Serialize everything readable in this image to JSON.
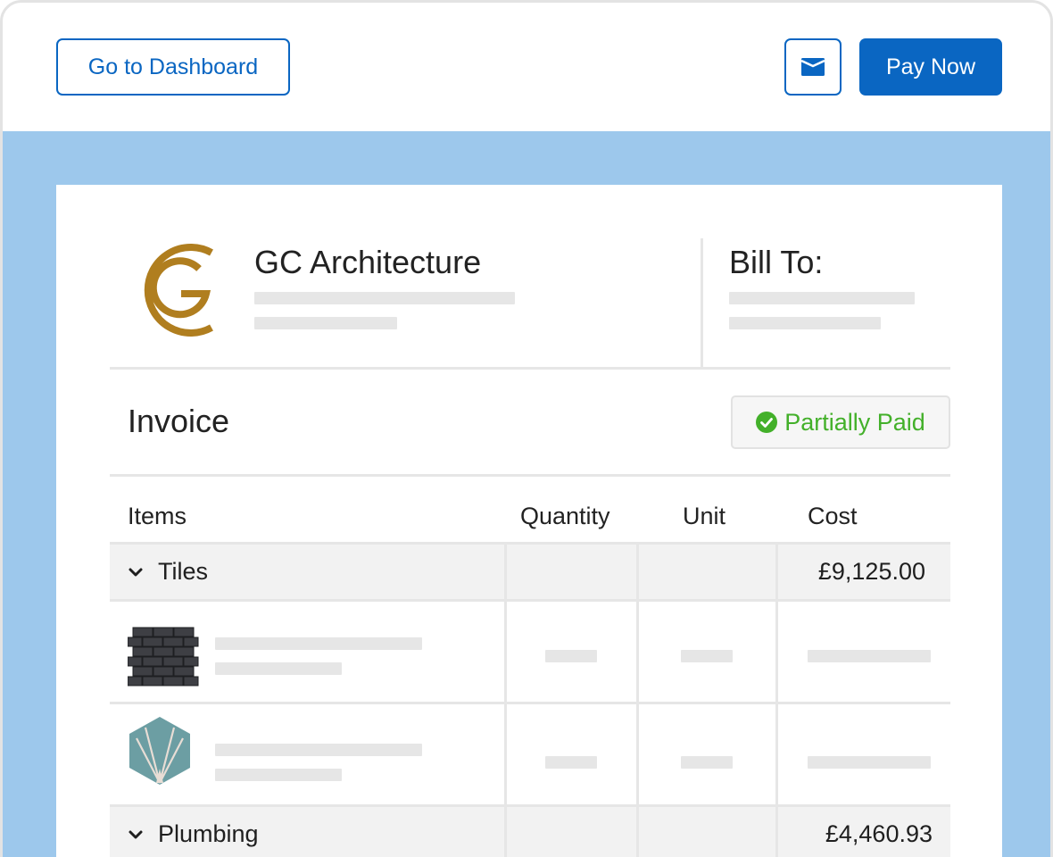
{
  "toolbar": {
    "dashboard_label": "Go to Dashboard",
    "pay_label": "Pay Now",
    "mail_icon": "envelope-icon"
  },
  "company": {
    "name": "GC Architecture",
    "logo": "gc-monogram-logo",
    "logo_color": "#b07e1f"
  },
  "bill_to": {
    "label": "Bill To:"
  },
  "invoice": {
    "title": "Invoice",
    "status": "Partially Paid",
    "status_color": "#43b02a"
  },
  "table": {
    "headers": [
      "Items",
      "Quantity",
      "Unit",
      "Cost"
    ],
    "groups": [
      {
        "name": "Tiles",
        "cost": "£9,125.00"
      },
      {
        "name": "Plumbing",
        "cost": "£4,460.93"
      }
    ],
    "items": [
      {
        "thumbnail": "dark-brick-tile-thumbnail"
      },
      {
        "thumbnail": "hexagon-tile-thumbnail"
      }
    ]
  },
  "colors": {
    "accent": "#0a66c2",
    "background_band": "#9dc8ec",
    "placeholder": "#e6e6e6"
  }
}
